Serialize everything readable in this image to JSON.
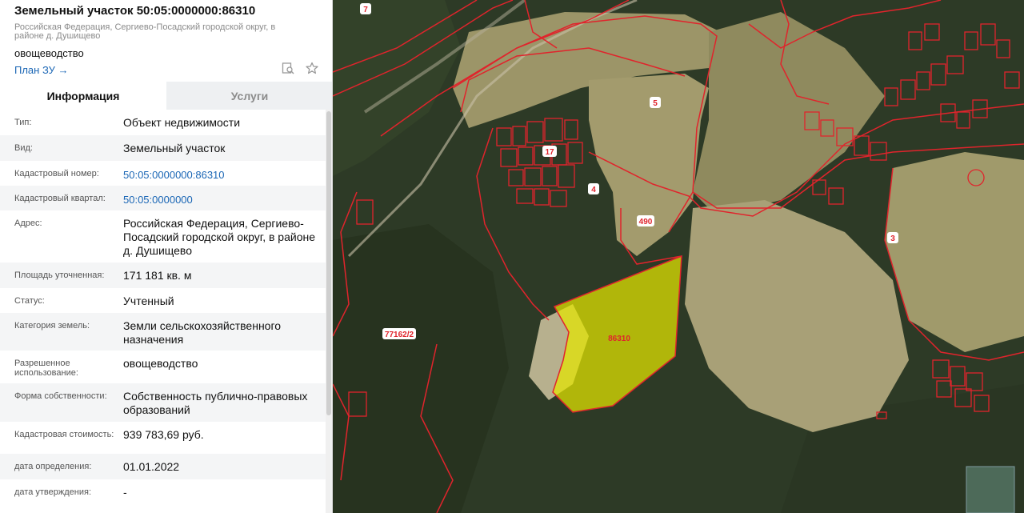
{
  "header": {
    "title": "Земельный участок 50:05:0000000:86310",
    "subtitle": "Российская Федерация, Сергиево-Посадский городской округ, в районе д. Душищево",
    "use": "овощеводство",
    "plan_link": "План ЗУ",
    "plan_link_arrow": "→",
    "icons": [
      "map-search-icon",
      "star-icon"
    ]
  },
  "tabs": [
    {
      "label": "Информация",
      "active": true
    },
    {
      "label": "Услуги",
      "active": false
    }
  ],
  "rows": [
    {
      "label": "Тип:",
      "value": "Объект недвижимости"
    },
    {
      "label": "Вид:",
      "value": "Земельный участок"
    },
    {
      "label": "Кадастровый номер:",
      "value": "50:05:0000000:86310"
    },
    {
      "label": "Кадастровый квартал:",
      "value": "50:05:0000000"
    },
    {
      "label": "Адрес:",
      "value": "Российская Федерация, Сергиево-Посадский городской округ, в районе д. Душищево"
    },
    {
      "label": "Площадь уточненная:",
      "value": "171 181 кв. м"
    },
    {
      "label": "Статус:",
      "value": "Учтенный"
    },
    {
      "label": "Категория земель:",
      "value": "Земли сельскохозяйственного назначения"
    },
    {
      "label": "Разрешенное использование:",
      "value": "овощеводство"
    },
    {
      "label": "Форма собственности:",
      "value": "Собственность публично-правовых образований"
    },
    {
      "label": "Кадастровая стоимость:",
      "value": "939 783,69 руб."
    },
    {
      "label": "дата определения:",
      "value": "01.01.2022"
    },
    {
      "label": "дата утверждения:",
      "value": "-"
    }
  ],
  "map": {
    "labels": {
      "l7": "7",
      "l5": "5",
      "l17": "17",
      "l4": "4",
      "l490": "490",
      "l3": "3",
      "l77162": "77162/2",
      "l86310": "86310"
    },
    "colors": {
      "boundary": "#e0242c",
      "selected_fill": "#e5e600",
      "field": "#9a9466",
      "forest": "#2e3a27"
    }
  }
}
